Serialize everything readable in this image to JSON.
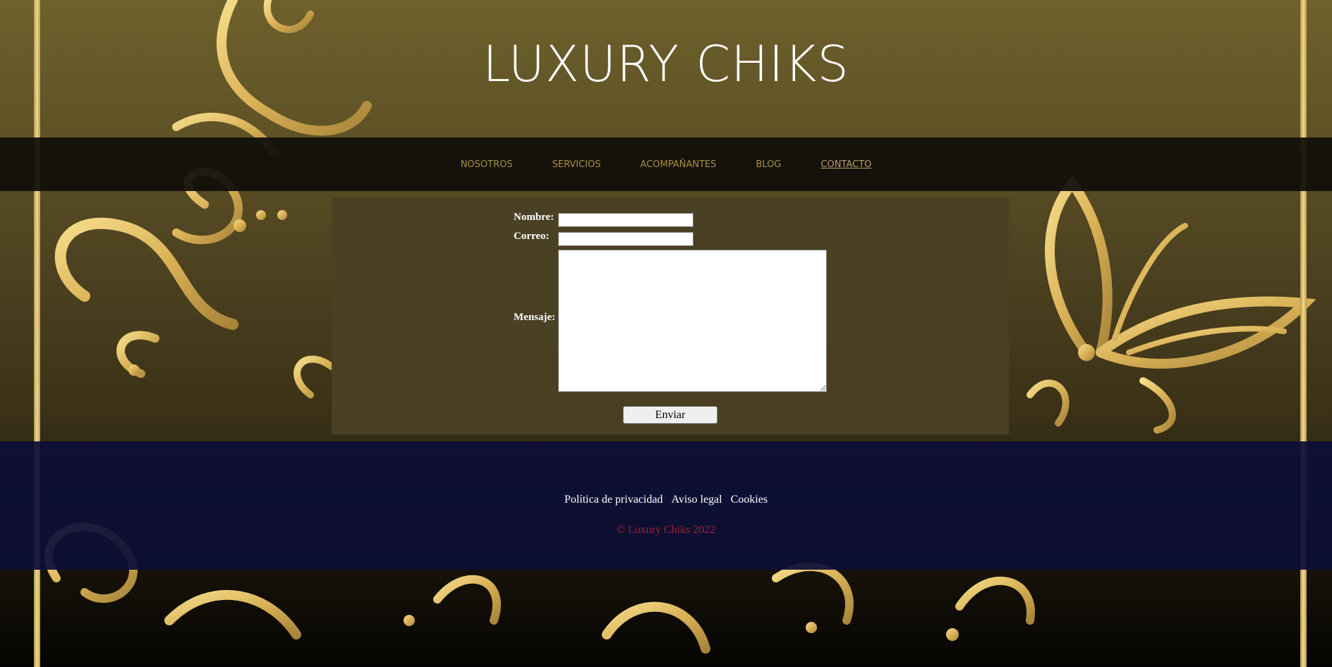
{
  "site": {
    "title": "LUXURY CHIKS"
  },
  "nav": {
    "items": [
      {
        "label": "NOSOTROS"
      },
      {
        "label": "SERVICIOS"
      },
      {
        "label": "ACOMPAÑANTES"
      },
      {
        "label": "BLOG"
      },
      {
        "label": "CONTACTO",
        "active": true
      }
    ]
  },
  "form": {
    "name_label": "Nombre:",
    "name_value": "",
    "email_label": "Correo:",
    "email_value": "",
    "message_label": "Mensaje:",
    "message_value": "",
    "submit_label": "Enviar"
  },
  "footer": {
    "links": [
      {
        "label": "Política de privacidad"
      },
      {
        "label": "Aviso legal"
      },
      {
        "label": "Cookies"
      }
    ],
    "copyright": "© Luxury Chiks 2022"
  },
  "colors": {
    "nav_text": "#a8913f",
    "footer_bg": "#0d0e37",
    "copyright": "#9c2431",
    "gold_ornament": "#e6c462"
  }
}
